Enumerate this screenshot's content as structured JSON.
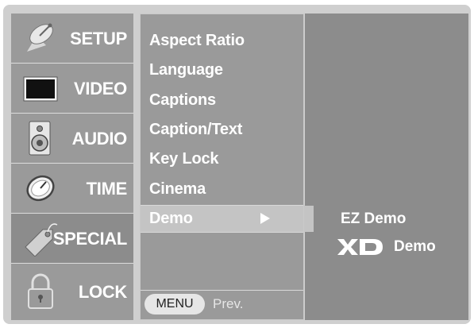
{
  "categories": [
    {
      "label": "SETUP",
      "icon": "satellite-dish-icon"
    },
    {
      "label": "VIDEO",
      "icon": "tv-screen-icon"
    },
    {
      "label": "AUDIO",
      "icon": "speaker-icon"
    },
    {
      "label": "TIME",
      "icon": "clock-icon"
    },
    {
      "label": "SPECIAL",
      "icon": "tag-icon"
    },
    {
      "label": "LOCK",
      "icon": "padlock-icon"
    }
  ],
  "active_category": "SPECIAL",
  "submenu": {
    "items": [
      "Aspect Ratio",
      "Language",
      "Captions",
      "Caption/Text",
      "Key Lock",
      "Cinema"
    ],
    "selected": "Demo"
  },
  "options": {
    "ez_demo": "EZ Demo",
    "xd_logo": "XD",
    "xd_demo": "Demo"
  },
  "footer": {
    "menu_button": "MENU",
    "prev": "Prev."
  },
  "colors": {
    "frame": "#cfcfcf",
    "panel": "#9a9a9a",
    "selected_row": "#c4c4c4",
    "text": "#ffffff"
  }
}
